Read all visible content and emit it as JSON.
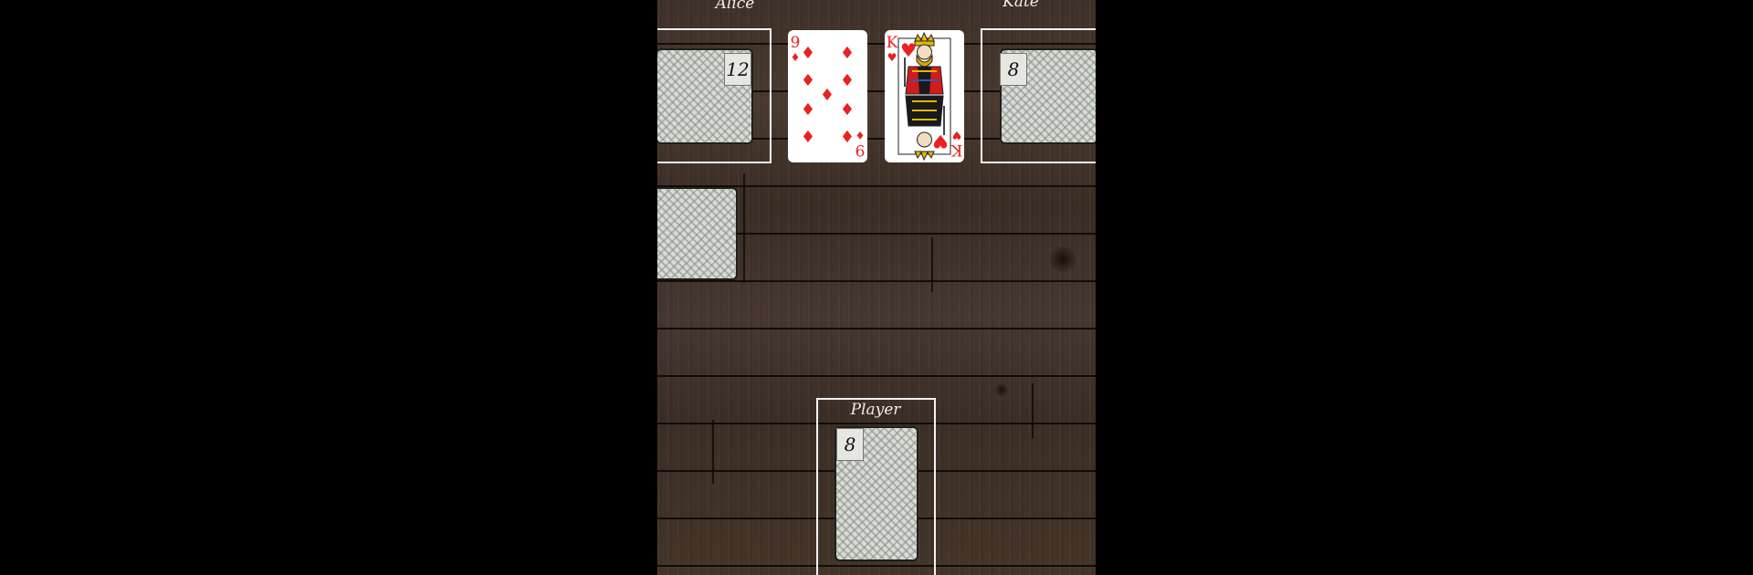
{
  "players": {
    "left": {
      "name": "Alice",
      "card_count": "12"
    },
    "right": {
      "name": "Kate",
      "card_count": "8"
    },
    "bottom": {
      "name": "Player",
      "card_count": "8"
    }
  },
  "table_cards": [
    {
      "rank": "9",
      "suit": "diamonds",
      "suit_symbol": "♦"
    },
    {
      "rank": "K",
      "suit": "hearts",
      "suit_symbol": "♥"
    }
  ],
  "deck": {
    "face": "down"
  },
  "colors": {
    "felt": "#3f3129",
    "red_suit": "#e8221f",
    "frame": "#f2f2f2"
  }
}
